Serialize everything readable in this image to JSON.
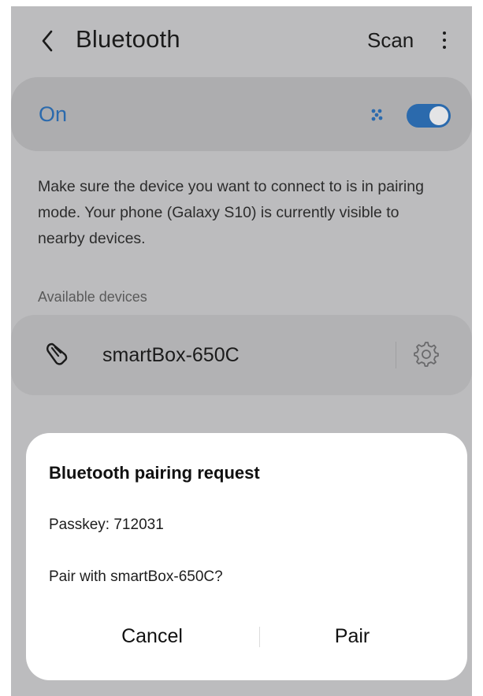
{
  "header": {
    "title": "Bluetooth",
    "scan_label": "Scan",
    "back_icon": "chevron-left-icon",
    "more_icon": "more-vertical-icon"
  },
  "bluetooth_toggle": {
    "label": "On",
    "state": "on",
    "accent_color": "#2b6aad"
  },
  "description": "Make sure the device you want to connect to is in pairing mode. Your phone (Galaxy S10) is currently visible to nearby devices.",
  "available_devices": {
    "heading": "Available devices",
    "items": [
      {
        "name": "smartBox-650C",
        "icon": "headset-icon",
        "settings_icon": "gear-icon"
      }
    ]
  },
  "pairing_dialog": {
    "title": "Bluetooth pairing request",
    "passkey": "Passkey: 712031",
    "question": "Pair with smartBox-650C?",
    "cancel_label": "Cancel",
    "pair_label": "Pair"
  }
}
